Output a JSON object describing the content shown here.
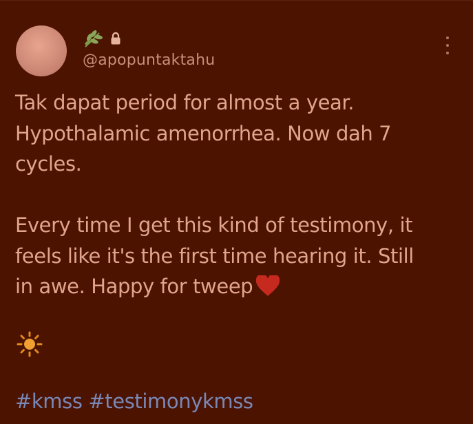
{
  "tweet": {
    "handle": "@apopuntaktahu",
    "icons": [
      "herb-icon",
      "lock-icon",
      "more-options-icon",
      "red-heart-icon",
      "sun-icon"
    ],
    "paragraphs": [
      "Tak dapat period for almost a year.\nHypothalamic amenorrhea. Now dah 7\ncycles.",
      "Every time I get this kind of testimony, it\nfeels like it's the first time hearing it. Still\nin awe. Happy for tweep"
    ],
    "hashtags": [
      "#kmss",
      "#testimonykmss"
    ],
    "colors": {
      "background": "#4b1300",
      "text": "#e2a48c",
      "hashtag": "#7a88b8",
      "handle": "#c98f7d"
    }
  }
}
